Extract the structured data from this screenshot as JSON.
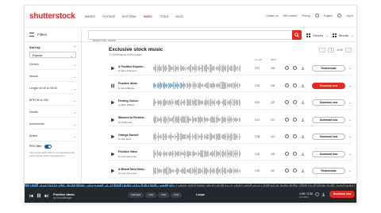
{
  "logo": "shutterstock",
  "nav": [
    "IMAGES",
    "FOOTAGE",
    "EDITORIAL",
    "MUSIC",
    "TOOLS",
    "BLOG"
  ],
  "nav_active": "MUSIC",
  "right_nav": [
    "Contact us",
    "Sell content",
    "Pricing",
    "English",
    "Log in"
  ],
  "filters_label": "Filters",
  "search_placeholder": "Search for music",
  "genres_label": "Genres",
  "moods_label": "Moods",
  "sidebar": {
    "sort_label": "Sort by",
    "sort_value": "Popular",
    "sections": [
      "Genres",
      "Moods",
      "Length 00:00 to 05:00",
      "BPM 50 to 250",
      "Vocals",
      "Instruments",
      "Artists"
    ],
    "pro_label": "PRO filter",
    "note": "Only show music that is not registered with performance rights organizations."
  },
  "main": {
    "title": "Exclusive stock music",
    "subtitle": "71 Shutterstock Select tracks",
    "col_length": "Length",
    "col_bpm": "BPM",
    "page_current": "1",
    "page_total": "of 62",
    "tracks": [
      {
        "title": "A Positive Experie...",
        "artist": "by Dave Rudasters",
        "length": "2:37",
        "bpm": "140",
        "action": "Redownload",
        "active": false
      },
      {
        "title": "Positive Ideas",
        "artist": "by SoundBeagle",
        "length": "2:30",
        "bpm": "105",
        "action": "Download now",
        "active": true
      },
      {
        "title": "Feeling Colors",
        "artist": "by Marc Wallach",
        "length": "3:02",
        "bpm": "120",
        "action": "Download now",
        "active": false
      },
      {
        "title": "Moment to Remem...",
        "artist": "by FMSounds",
        "length": "2:21",
        "bpm": "172",
        "action": "Download now",
        "active": false
      },
      {
        "title": "Orange Sunset",
        "artist": "by Dan Rose",
        "length": "2:38",
        "bpm": "113",
        "action": "Download now",
        "active": false
      },
      {
        "title": "Positive Vibes",
        "artist": "by Lost Harmonies",
        "length": "2:18",
        "bpm": "120",
        "action": "Download now",
        "active": false
      },
      {
        "title": "A Brand New Horiz...",
        "artist": "by Lost Harmonies",
        "length": "2:25",
        "bpm": "112",
        "action": "Redownload",
        "active": false
      }
    ]
  },
  "player": {
    "title": "Positive Ideas",
    "artist": "by SoundBeagle",
    "pills": [
      "Full track",
      "1:00",
      "0:30",
      "0:15"
    ],
    "loops": "Loops",
    "time": "1:09 / 2:30",
    "bpm": "105 BPM",
    "download": "Download now"
  },
  "colors": {
    "accent": "#e8271f",
    "link": "#1f5f9c",
    "player_bg": "#23282d"
  }
}
